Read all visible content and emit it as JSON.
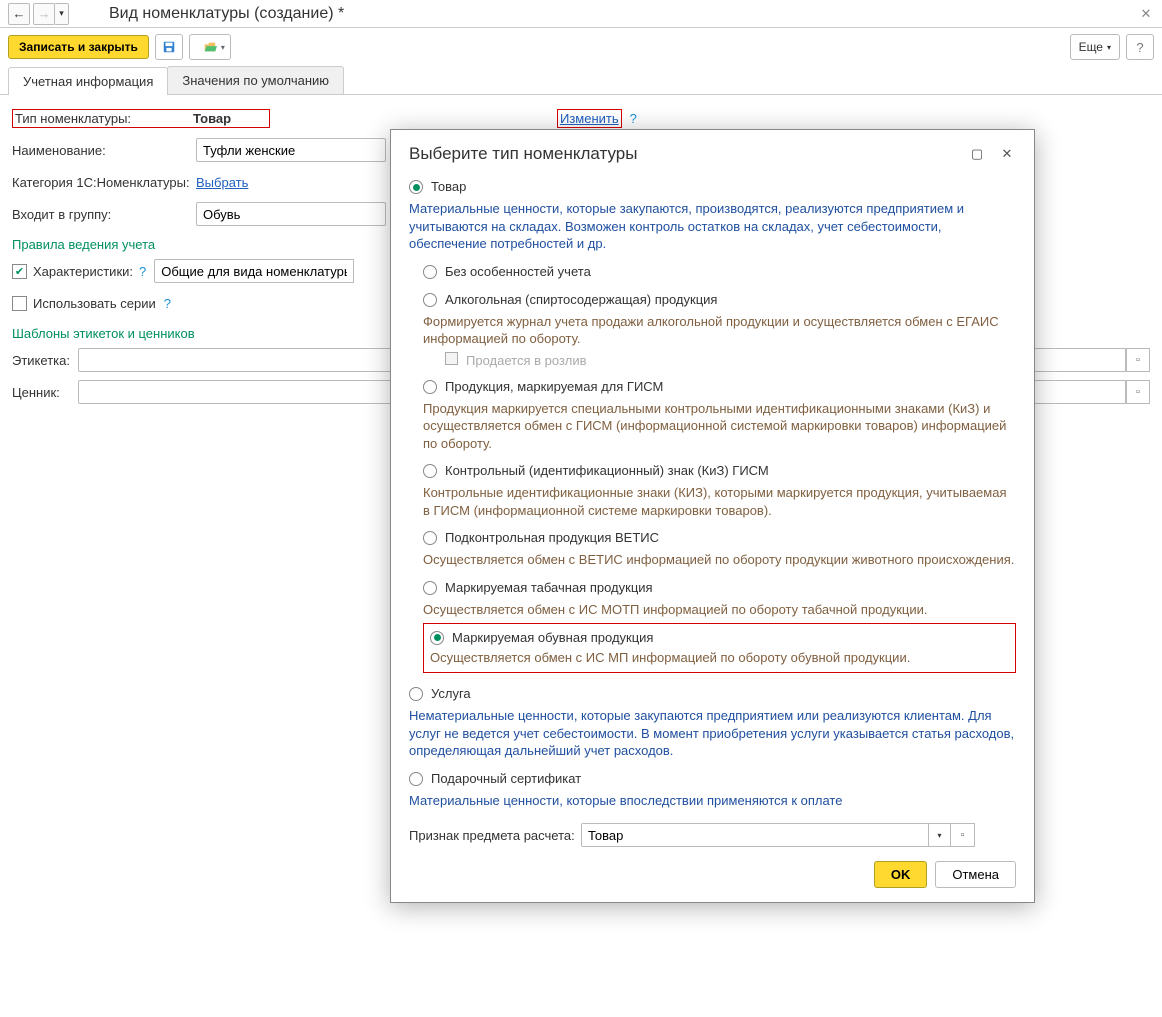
{
  "title": "Вид номенклатуры  (создание) *",
  "toolbar": {
    "save_close": "Записать и закрыть",
    "more": "Еще"
  },
  "tabs": {
    "accounting": "Учетная информация",
    "defaults": "Значения по умолчанию"
  },
  "form": {
    "type_label": "Тип номенклатуры:",
    "type_value": "Товар",
    "change": "Изменить",
    "name_label": "Наименование:",
    "name_value": "Туфли женские",
    "category_label": "Категория 1С:Номенклатуры:",
    "category_link": "Выбрать",
    "group_label": "Входит в группу:",
    "group_value": "Обувь",
    "rules_section": "Правила ведения учета",
    "characteristics_label": "Характеристики:",
    "characteristics_value": "Общие для вида номенклатуры",
    "use_series_label": "Использовать серии",
    "templates_section": "Шаблоны этикеток и ценников",
    "label_label": "Этикетка:",
    "price_tag_label": "Ценник:"
  },
  "modal": {
    "title": "Выберите тип номенклатуры",
    "opt_tovar": "Товар",
    "opt_tovar_desc": "Материальные ценности, которые закупаются, производятся, реализуются предприятием и учитываются на складах. Возможен контроль остатков на складах, учет себестоимости, обеспечение потребностей и др.",
    "opt_no_special": "Без особенностей учета",
    "opt_alcohol": "Алкогольная (спиртосодержащая) продукция",
    "opt_alcohol_desc": "Формируется журнал учета продажи алкогольной продукции и осуществляется обмен с ЕГАИС информацией по обороту.",
    "opt_draft": "Продается в розлив",
    "opt_gism": "Продукция, маркируемая для ГИСМ",
    "opt_gism_desc": "Продукция маркируется специальными контрольными идентификационными знаками (КиЗ) и осуществляется обмен с ГИСМ (информационной системой маркировки товаров) информацией по обороту.",
    "opt_kiz": "Контрольный (идентификационный) знак (КиЗ) ГИСМ",
    "opt_kiz_desc": "Контрольные идентификационные знаки (КИЗ), которыми маркируется продукция, учитываемая в ГИСМ (информационной системе маркировки товаров).",
    "opt_vetis": "Подконтрольная продукция ВЕТИС",
    "opt_vetis_desc": "Осуществляется обмен с ВЕТИС информацией по обороту продукции животного происхождения.",
    "opt_tobacco": "Маркируемая табачная продукция",
    "opt_tobacco_desc": "Осуществляется обмен с ИС МОТП информацией по обороту табачной продукции.",
    "opt_shoes": "Маркируемая обувная продукция",
    "opt_shoes_desc": "Осуществляется обмен с ИС МП информацией по обороту обувной продукции.",
    "opt_service": "Услуга",
    "opt_service_desc": "Нематериальные ценности, которые закупаются предприятием или реализуются клиентам. Для услуг не ведется учет себестоимости. В момент приобретения услуги указывается статья расходов, определяющая дальнейший учет расходов.",
    "opt_gift": "Подарочный сертификат",
    "opt_gift_desc": "Материальные ценности, которые впоследствии применяются к оплате",
    "subject_label": "Признак предмета расчета:",
    "subject_value": "Товар",
    "ok": "OK",
    "cancel": "Отмена"
  }
}
